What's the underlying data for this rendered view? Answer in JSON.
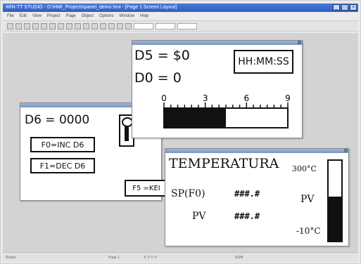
{
  "app": {
    "title": "WIN-TT STUDIO - D:\\HMI_Projects\\panel_demo.hmi - [Page 1 Screen Layout]",
    "menu": [
      "File",
      "Edit",
      "View",
      "Project",
      "Page",
      "Object",
      "Options",
      "Window",
      "Help"
    ]
  },
  "statusbar": {
    "left": "Ready",
    "mid1": "Page 1",
    "mid2": "X: 0  Y: 0",
    "right": "NUM"
  },
  "window_d5": {
    "d5_label": "D5 = $0",
    "d0_label": "D0 = 0",
    "time_box": "HH:MM:SS",
    "scale_ticks": [
      "0",
      "3",
      "6",
      "9"
    ],
    "bar_fill_fraction": 0.5
  },
  "window_d6": {
    "d6_label": "D6 = 0000",
    "f0_button": "F0=INC D6",
    "f1_button": "F1=DEC D6",
    "f5_button": "F5 =KEI"
  },
  "window_temp": {
    "title": "TEMPERATURA",
    "sp_label": "SP(F0)",
    "sp_value": "###.#",
    "pv_label": "PV",
    "pv_value": "###.#",
    "scale_max": "300°C",
    "scale_pv": "PV",
    "scale_min": "-10°C",
    "bar_fill_fraction": 0.55
  },
  "colors": {
    "title_bar": "#3a6ad0",
    "workspace": "#d3d3d3",
    "window_bg": "#ffffff",
    "ink": "#111111"
  }
}
